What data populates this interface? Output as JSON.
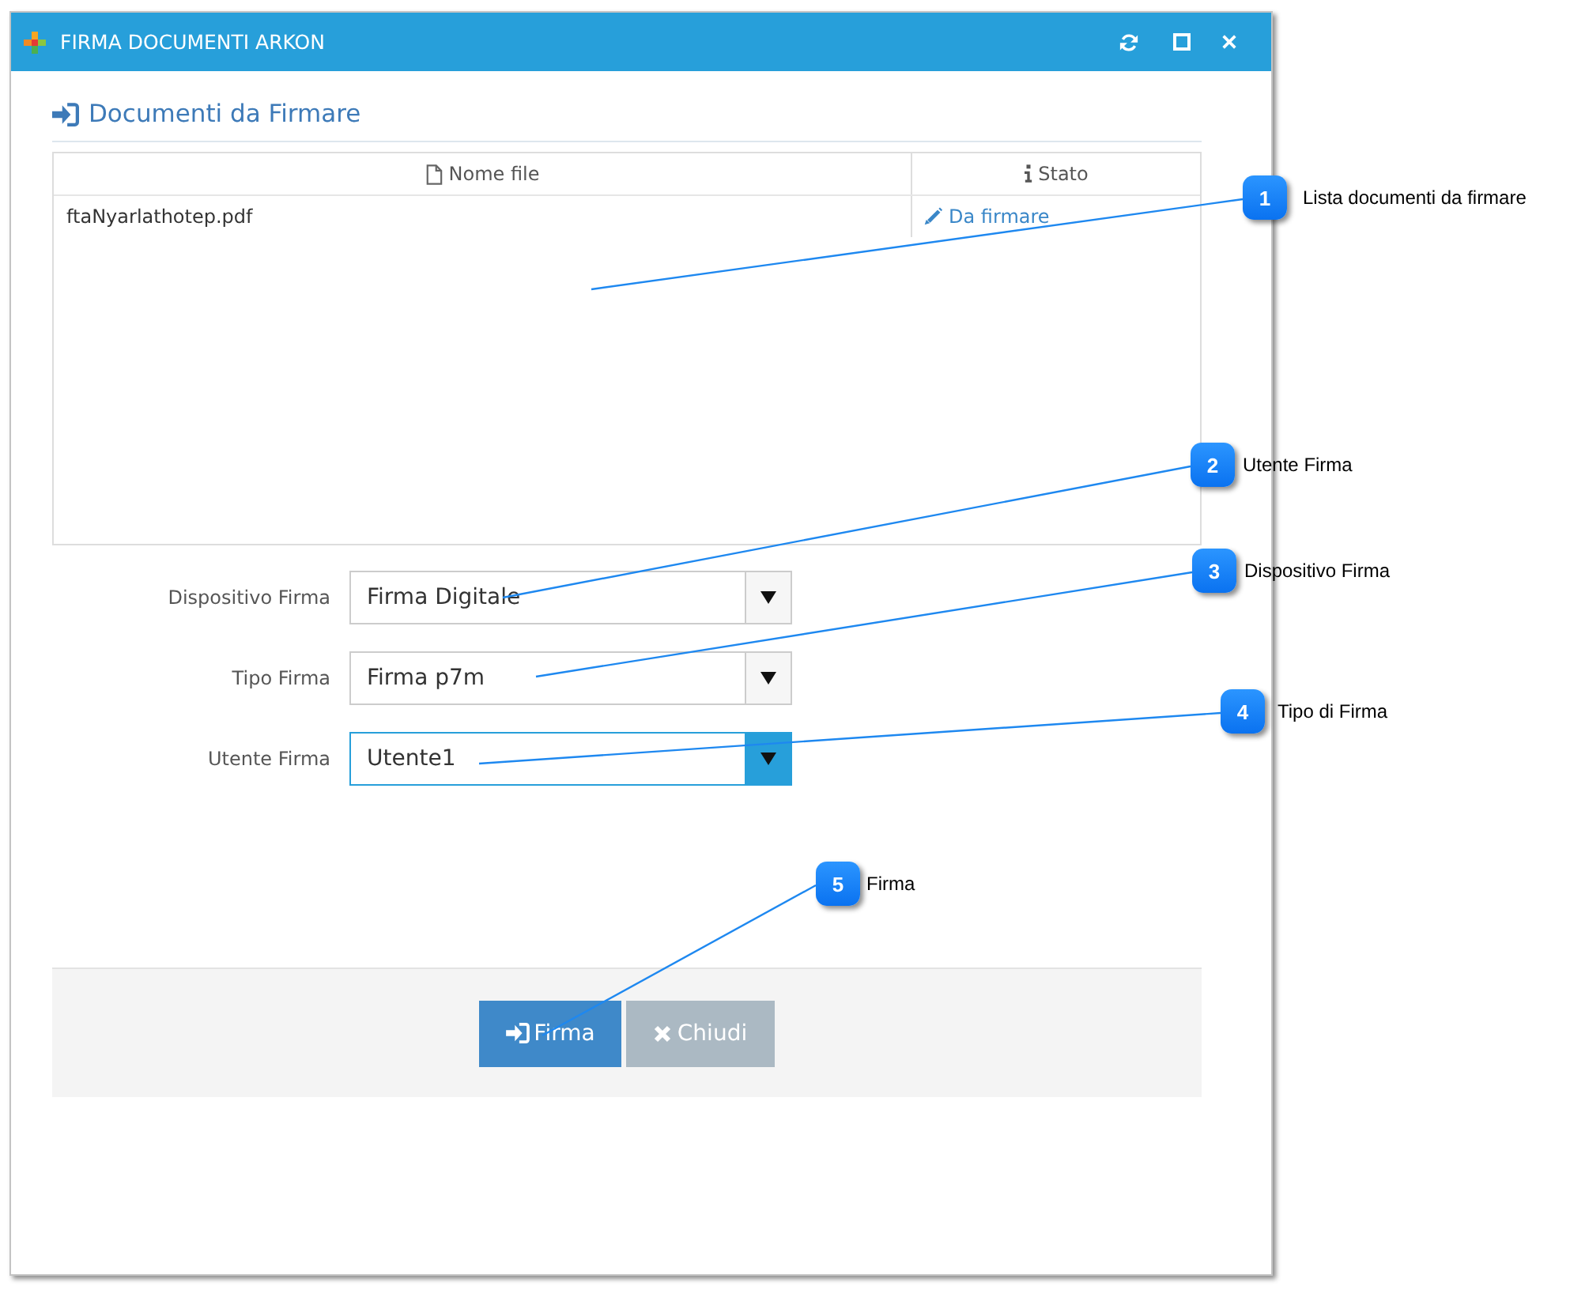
{
  "window": {
    "title": "FIRMA DOCUMENTI ARKON"
  },
  "section": {
    "title": "Documenti da Firmare"
  },
  "table": {
    "columns": [
      "Nome file",
      "Stato"
    ],
    "rows": [
      [
        "ftaNyarlathotep.pdf",
        "Da firmare"
      ]
    ]
  },
  "form": {
    "fields": [
      {
        "label": "Dispositivo Firma",
        "value": "Firma Digitale",
        "focused": false
      },
      {
        "label": "Tipo Firma",
        "value": "Firma p7m",
        "focused": false
      },
      {
        "label": "Utente Firma",
        "value": "Utente1",
        "focused": true
      }
    ]
  },
  "buttons": [
    {
      "label": "Firma",
      "kind": "primary"
    },
    {
      "label": "Chiudi",
      "kind": "secondary"
    }
  ],
  "callouts": [
    {
      "number": "1",
      "text": "Lista documenti da firmare"
    },
    {
      "number": "2",
      "text": "Utente Firma"
    },
    {
      "number": "3",
      "text": "Dispositivo Firma"
    },
    {
      "number": "4",
      "text": "Tipo di Firma"
    },
    {
      "number": "5",
      "text": "Firma"
    }
  ]
}
